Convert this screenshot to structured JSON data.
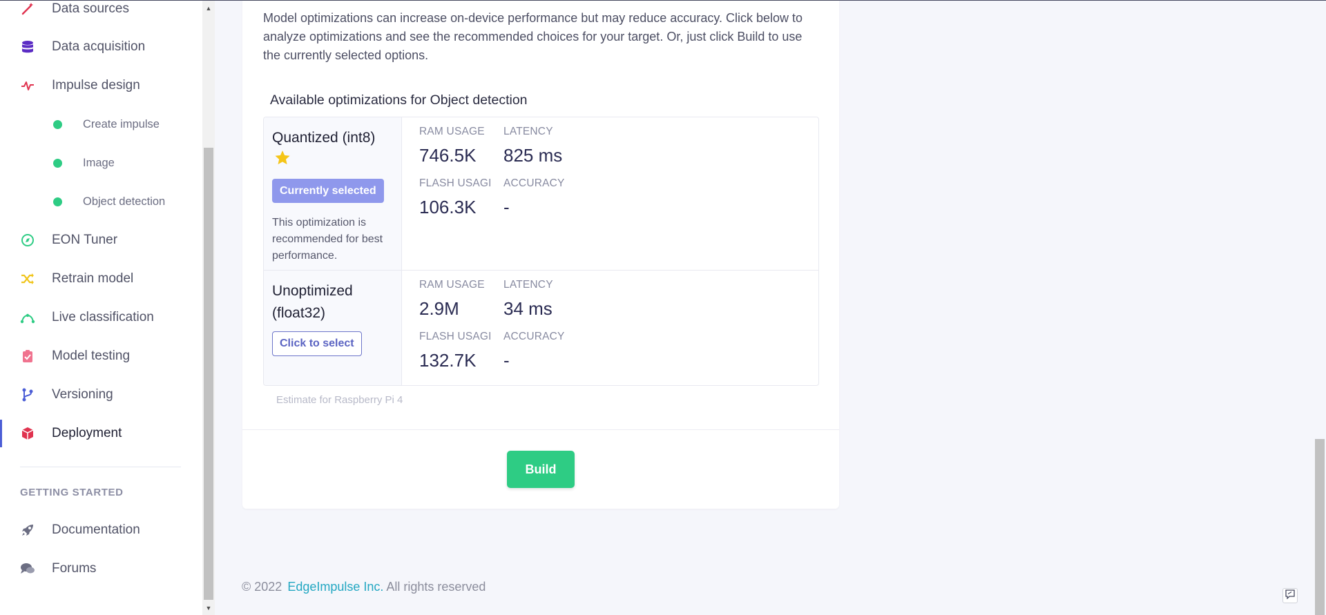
{
  "sidebar": {
    "items": [
      {
        "label": "Data sources",
        "icon": "magic-wand-icon",
        "color": "#e0334f"
      },
      {
        "label": "Data acquisition",
        "icon": "database-icon",
        "color": "#5b2cc4"
      },
      {
        "label": "Impulse design",
        "icon": "pulse-icon",
        "color": "#e0334f"
      },
      {
        "label": "Create impulse",
        "icon": "dot-icon",
        "color": "#2ecc84"
      },
      {
        "label": "Image",
        "icon": "dot-icon",
        "color": "#2ecc84"
      },
      {
        "label": "Object detection",
        "icon": "dot-icon",
        "color": "#2ecc84"
      },
      {
        "label": "EON Tuner",
        "icon": "compass-icon",
        "color": "#2ecc84"
      },
      {
        "label": "Retrain model",
        "icon": "shuffle-icon",
        "color": "#f0c419"
      },
      {
        "label": "Live classification",
        "icon": "curve-icon",
        "color": "#2ecc84"
      },
      {
        "label": "Model testing",
        "icon": "clipboard-check-icon",
        "color": "#f0738f"
      },
      {
        "label": "Versioning",
        "icon": "branch-icon",
        "color": "#4c5ed6"
      },
      {
        "label": "Deployment",
        "icon": "box-icon",
        "color": "#e0334f"
      }
    ],
    "section_title": "GETTING STARTED",
    "getting_started": [
      {
        "label": "Documentation",
        "icon": "rocket-icon"
      },
      {
        "label": "Forums",
        "icon": "chat-icon"
      }
    ]
  },
  "main": {
    "intro": "Model optimizations can increase on-device performance but may reduce accuracy. Click below to analyze optimizations and see the recommended choices for your target. Or, just click Build to use the currently selected options.",
    "available_title": "Available optimizations for Object detection",
    "options": [
      {
        "name": "Quantized (int8)",
        "badge": "Currently selected",
        "description": "This optimization is recommended for best performance.",
        "ram_label": "RAM USAGE",
        "ram": "746.5K",
        "latency_label": "LATENCY",
        "latency": "825 ms",
        "flash_label": "FLASH USAGE",
        "flash": "106.3K",
        "accuracy_label": "ACCURACY",
        "accuracy": "-"
      },
      {
        "name": "Unoptimized (float32)",
        "select_label": "Click to select",
        "ram_label": "RAM USAGE",
        "ram": "2.9M",
        "latency_label": "LATENCY",
        "latency": "34 ms",
        "flash_label": "FLASH USAGE",
        "flash": "132.7K",
        "accuracy_label": "ACCURACY",
        "accuracy": "-"
      }
    ],
    "estimate": "Estimate for Raspberry Pi 4",
    "build_label": "Build"
  },
  "footer": {
    "copyright": "© 2022",
    "company": "EdgeImpulse Inc.",
    "rights": "All rights reserved"
  }
}
